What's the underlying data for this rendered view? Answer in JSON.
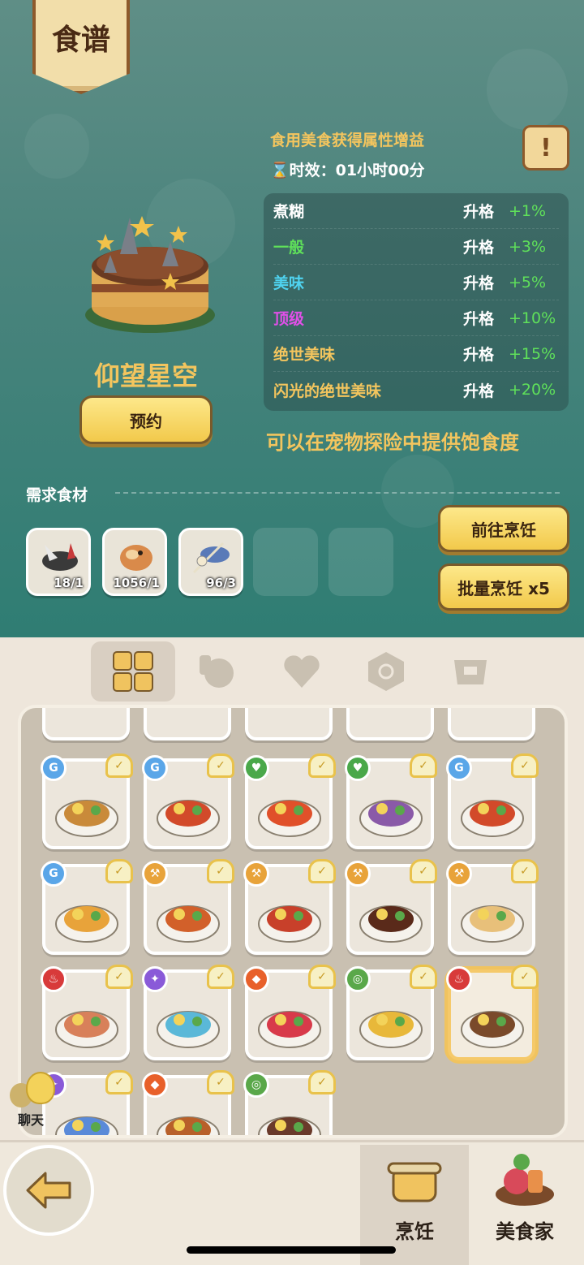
{
  "header": {
    "title": "食谱"
  },
  "buff": {
    "title": "食用美食获得属性增益",
    "time_prefix": "⌛",
    "time_label": "时效：01小时00分"
  },
  "qualities": [
    {
      "name": "煮糊",
      "color": "#ffffff",
      "upgrade": "升格",
      "bonus": "+1%"
    },
    {
      "name": "一般",
      "color": "#5fe05a",
      "upgrade": "升格",
      "bonus": "+3%"
    },
    {
      "name": "美味",
      "color": "#4fd3f0",
      "upgrade": "升格",
      "bonus": "+5%"
    },
    {
      "name": "顶级",
      "color": "#e050e8",
      "upgrade": "升格",
      "bonus": "+10%"
    },
    {
      "name": "绝世美味",
      "color": "#f3c55e",
      "upgrade": "升格",
      "bonus": "+15%"
    },
    {
      "name": "闪光的绝世美味",
      "color": "#f3c55e",
      "upgrade": "升格",
      "bonus": "+20%"
    }
  ],
  "dish": {
    "name": "仰望星空",
    "reserve_label": "预约"
  },
  "expedition_note": "可以在宠物探险中提供饱食度",
  "ingredients": {
    "label": "需求食材",
    "items": [
      {
        "icon": "fish-bone-icon",
        "count": "18/1"
      },
      {
        "icon": "bread-bird-icon",
        "count": "1056/1"
      },
      {
        "icon": "swordfish-icon",
        "count": "96/3"
      }
    ]
  },
  "actions": {
    "go_cook": "前往烹饪",
    "batch_cook": "批量烹饪 x5"
  },
  "tabs": [
    "all-recipes-icon",
    "meat-icon",
    "heart-icon",
    "spiral-icon",
    "helmet-icon"
  ],
  "recipe_rows": [
    [
      {
        "tag": "G",
        "tag_color": "#5aa6e8",
        "plate": "#c98a3a"
      },
      {
        "tag": "G",
        "tag_color": "#5aa6e8",
        "plate": "#d24a2a"
      },
      {
        "tag": "♥",
        "tag_color": "#4aa84a",
        "plate": "#e0502a"
      },
      {
        "tag": "♥",
        "tag_color": "#4aa84a",
        "plate": "#8a5aa8"
      },
      {
        "tag": "G",
        "tag_color": "#5aa6e8",
        "plate": "#d24a2a"
      }
    ],
    [
      {
        "tag": "G",
        "tag_color": "#5aa6e8",
        "plate": "#e8a33a"
      },
      {
        "tag": "⚒",
        "tag_color": "#e8a33a",
        "plate": "#d2602a"
      },
      {
        "tag": "⚒",
        "tag_color": "#e8a33a",
        "plate": "#c8402a"
      },
      {
        "tag": "⚒",
        "tag_color": "#e8a33a",
        "plate": "#5a2a1a"
      },
      {
        "tag": "⚒",
        "tag_color": "#e8a33a",
        "plate": "#e8c07a"
      }
    ],
    [
      {
        "tag": "♨",
        "tag_color": "#d83a3a",
        "plate": "#d8805a"
      },
      {
        "tag": "✦",
        "tag_color": "#8a5ad8",
        "plate": "#5ab8d8"
      },
      {
        "tag": "◆",
        "tag_color": "#e8602a",
        "plate": "#d83a4a"
      },
      {
        "tag": "◎",
        "tag_color": "#5aa84a",
        "plate": "#e8b83a"
      },
      {
        "tag": "♨",
        "tag_color": "#d83a3a",
        "plate": "#7a4a2a"
      }
    ],
    [
      {
        "tag": "✦",
        "tag_color": "#8a5ad8",
        "plate": "#5a8ad8"
      },
      {
        "tag": "◆",
        "tag_color": "#e8602a",
        "plate": "#b8602a"
      },
      {
        "tag": "◎",
        "tag_color": "#5aa84a",
        "plate": "#6a3a2a"
      }
    ]
  ],
  "chat": {
    "label": "聊天"
  },
  "nav": {
    "cook_label": "烹饪",
    "gourmet_label": "美食家"
  }
}
